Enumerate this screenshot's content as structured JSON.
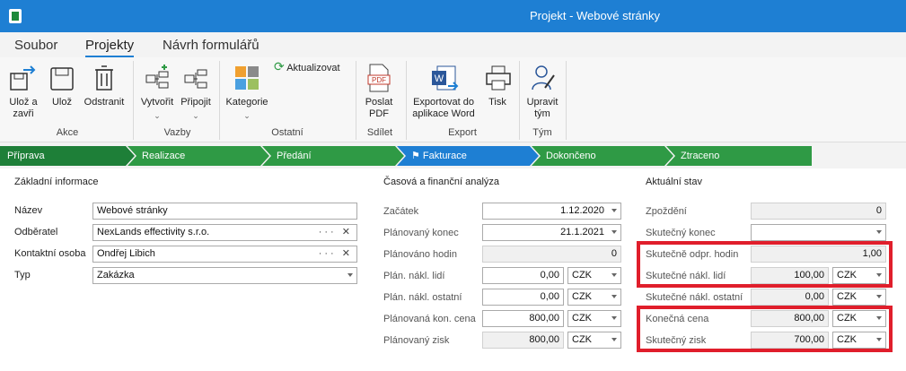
{
  "window": {
    "title": "Projekt - Webové stránky"
  },
  "menu": {
    "tabs": [
      "Soubor",
      "Projekty",
      "Návrh formulářů"
    ]
  },
  "ribbon": {
    "buttons": {
      "save_close": "Ulož a zavři",
      "save": "Ulož",
      "delete": "Odstranit",
      "create": "Vytvořit",
      "attach": "Připojit",
      "category": "Kategorie",
      "refresh": "Aktualizovat",
      "send_pdf": "Poslat PDF",
      "export_word": "Exportovat do aplikace Word",
      "print": "Tisk",
      "edit_team": "Upravit tým",
      "pdf_badge": "PDF",
      "word_badge": "W"
    },
    "groups": {
      "akce": "Akce",
      "vazby": "Vazby",
      "ostatni": "Ostatní",
      "sdilet": "Sdílet",
      "export": "Export",
      "tym": "Tým"
    }
  },
  "stages": [
    "Příprava",
    "Realizace",
    "Předání",
    "Fakturace",
    "Dokončeno",
    "Ztraceno"
  ],
  "basic": {
    "heading": "Základní informace",
    "name_label": "Název",
    "name_value": "Webové stránky",
    "customer_label": "Odběratel",
    "customer_value": "NexLands effectivity s.r.o.",
    "contact_label": "Kontaktní osoba",
    "contact_value": "Ondřej Libich",
    "type_label": "Typ",
    "type_value": "Zakázka",
    "icons": "··· ✕"
  },
  "finance": {
    "heading": "Časová a finanční analýza",
    "start_label": "Začátek",
    "start_value": "1.12.2020",
    "end_label": "Plánovaný konec",
    "end_value": "21.1.2021",
    "hours_label": "Plánováno hodin",
    "hours_value": "0",
    "people_cost_label": "Plán. nákl. lidí",
    "people_cost_value": "0,00",
    "other_cost_label": "Plán. nákl. ostatní",
    "other_cost_value": "0,00",
    "price_label": "Plánovaná kon. cena",
    "price_value": "800,00",
    "profit_label": "Plánovaný zisk",
    "profit_value": "800,00",
    "currency": "CZK"
  },
  "status": {
    "heading": "Aktuální stav",
    "delay_label": "Zpoždění",
    "delay_value": "0",
    "real_end_label": "Skutečný konec",
    "real_end_value": "",
    "real_hours_label": "Skutečně odpr. hodin",
    "real_hours_value": "1,00",
    "real_people_label": "Skutečné nákl. lidí",
    "real_people_value": "100,00",
    "real_other_label": "Skutečné nákl. ostatní",
    "real_other_value": "0,00",
    "final_price_label": "Konečná cena",
    "final_price_value": "800,00",
    "real_profit_label": "Skutečný zisk",
    "real_profit_value": "700,00",
    "currency": "CZK"
  },
  "colors": {
    "accent": "#1e7fd3",
    "stage_green": "#2f9a45",
    "highlight": "#e01e2b"
  }
}
